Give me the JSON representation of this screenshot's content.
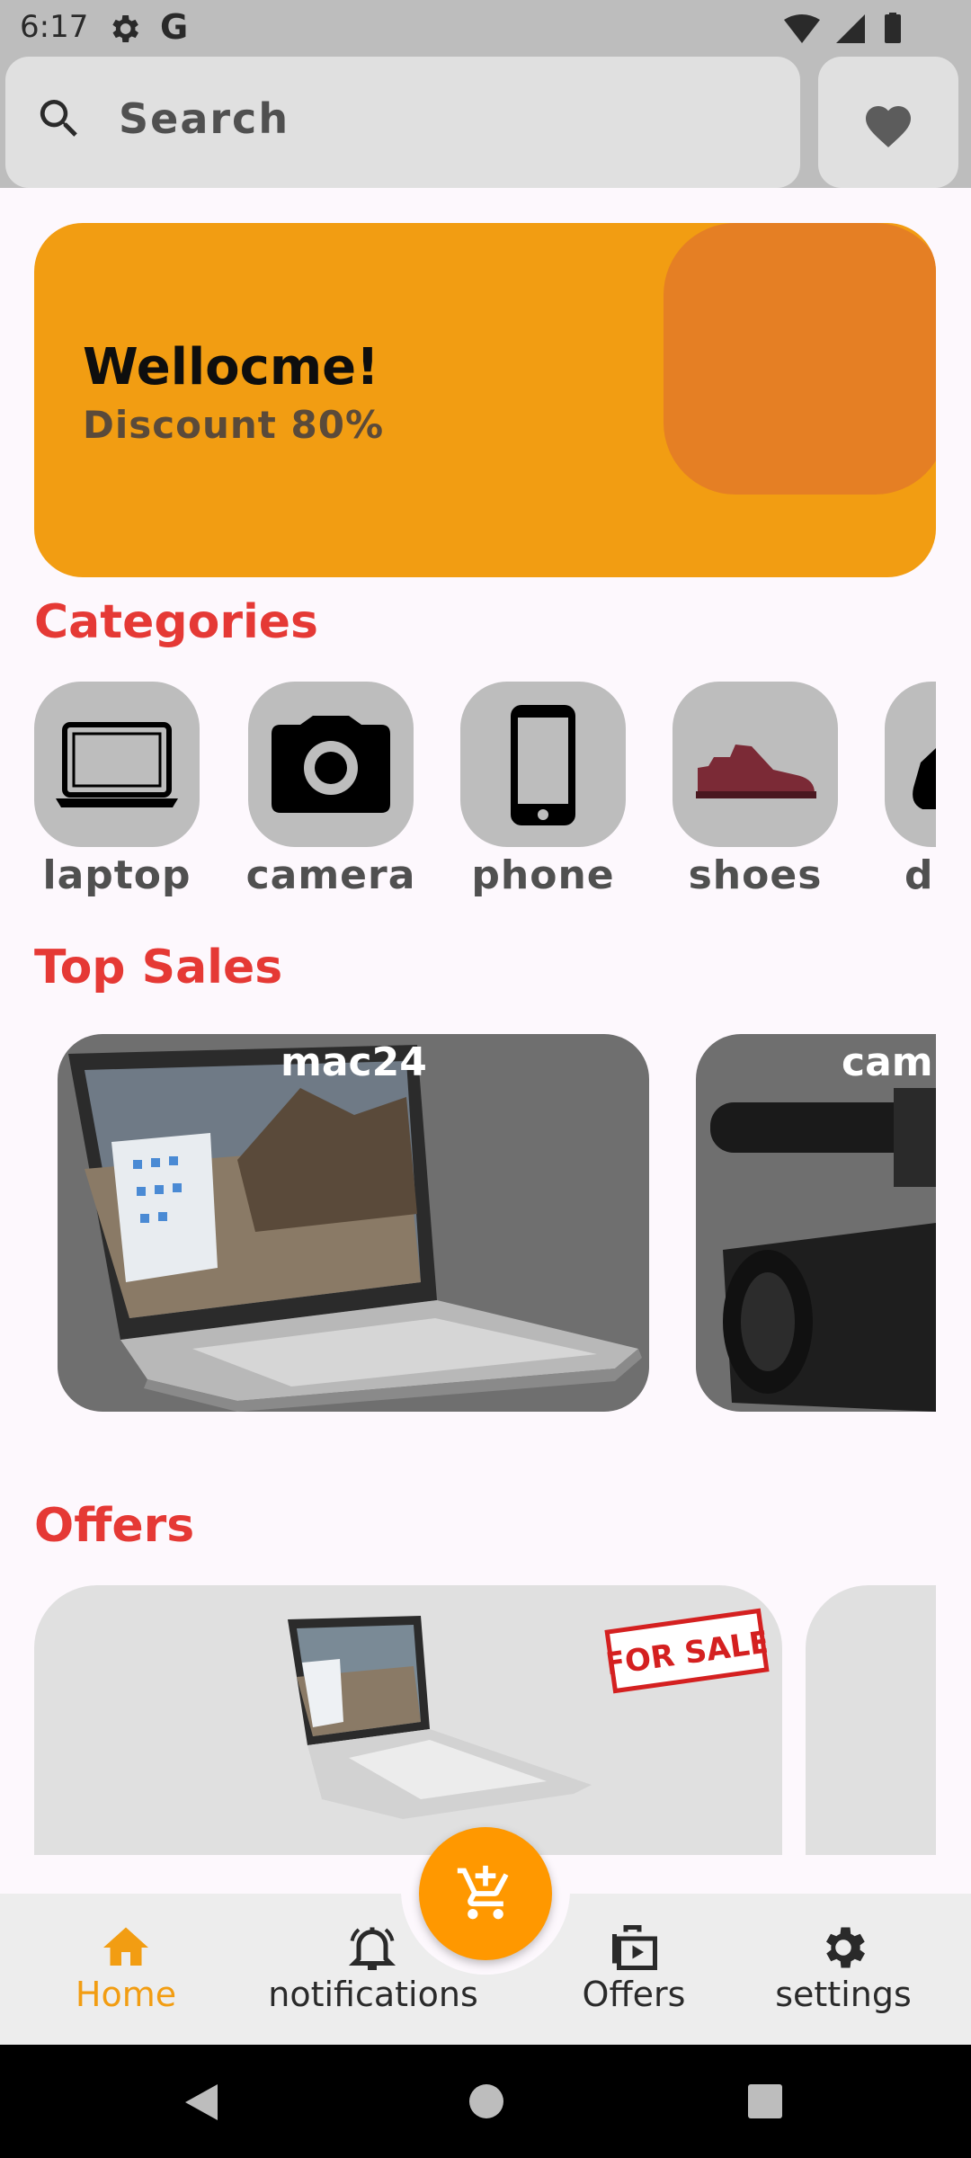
{
  "status_bar": {
    "time": "6:17",
    "google_letter": "G"
  },
  "search": {
    "label": "Search"
  },
  "banner": {
    "title": "Wellocme!",
    "subtitle": "Discount 80%"
  },
  "sections": {
    "categories": "Categories",
    "top_sales": "Top Sales",
    "offers": "Offers"
  },
  "categories": [
    {
      "label": "laptop",
      "icon": "laptop-icon"
    },
    {
      "label": "camera",
      "icon": "camera-icon"
    },
    {
      "label": "phone",
      "icon": "phone-icon"
    },
    {
      "label": "shoes",
      "icon": "shoe-icon"
    },
    {
      "label": "d",
      "icon": "partial-category-icon"
    }
  ],
  "top_sales": [
    {
      "title": "mac24"
    },
    {
      "title": "cam"
    }
  ],
  "offers": {
    "badge": "FOR SALE"
  },
  "bottom_nav": [
    {
      "label": "Home",
      "icon": "home-icon",
      "active": true
    },
    {
      "label": "notifications",
      "icon": "bell-icon",
      "active": false
    },
    {
      "label": "Offers",
      "icon": "offers-icon",
      "active": false
    },
    {
      "label": "settings",
      "icon": "gear-icon",
      "active": false
    }
  ],
  "colors": {
    "accent": "#ff9800",
    "banner": "#f29d12",
    "section_title": "#e53935",
    "active_nav": "#f29d12"
  }
}
